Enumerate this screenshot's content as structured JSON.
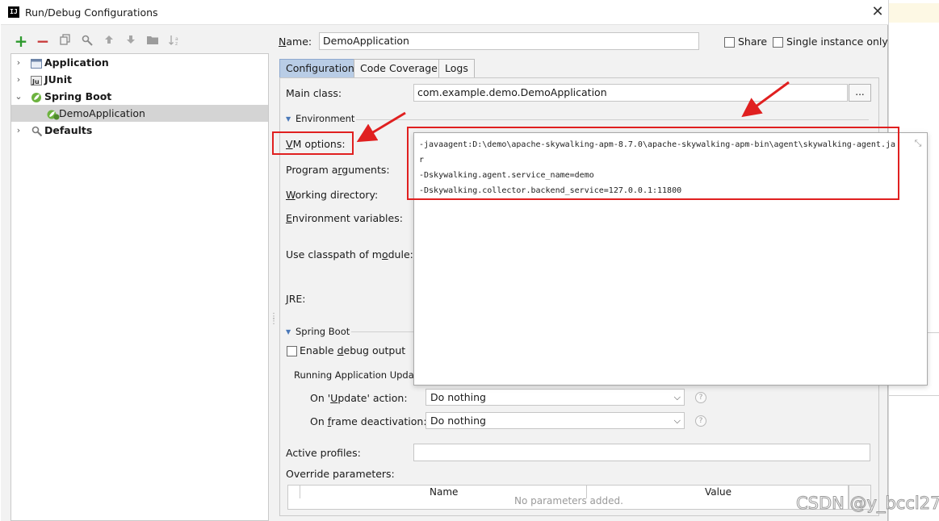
{
  "window": {
    "title": "Run/Debug Configurations",
    "app_icon": "IJ",
    "close_icon": "close-icon"
  },
  "toolbar": {
    "icons": [
      "add-icon",
      "remove-icon",
      "copy-icon",
      "edit-defaults-icon",
      "move-up-icon",
      "move-down-icon",
      "folder-icon",
      "sort-icon"
    ]
  },
  "tree": {
    "items": [
      {
        "label": "Application",
        "icon": "application-icon"
      },
      {
        "label": "JUnit",
        "icon": "junit-icon"
      },
      {
        "label": "Spring Boot",
        "icon": "spring-boot-icon"
      },
      {
        "label": "DemoApplication",
        "icon": "spring-app-icon"
      },
      {
        "label": "Defaults",
        "icon": "defaults-icon"
      }
    ]
  },
  "config": {
    "name_label": "Name:",
    "name_value": "DemoApplication",
    "share_label": "Share",
    "single_instance_label": "Single instance only",
    "tabs": [
      "Configuration",
      "Code Coverage",
      "Logs"
    ],
    "main_class_label": "Main class:",
    "main_class_value": "com.example.demo.DemoApplication",
    "browse_label": "...",
    "environment_section": "Environment",
    "vm_options_label": "VM options:",
    "program_arguments_label": "Program arguments:",
    "working_directory_label": "Working directory:",
    "environment_variables_label": "Environment variables:",
    "use_classpath_label": "Use classpath of module:",
    "jre_label": "JRE:",
    "spring_boot_section": "Spring Boot",
    "enable_debug_label": "Enable debug output",
    "running_updates_label": "Running Application Update",
    "on_update_label": "On 'Update' action:",
    "on_update_value": "Do nothing",
    "on_frame_label": "On frame deactivation:",
    "on_frame_value": "Do nothing",
    "active_profiles_label": "Active profiles:",
    "override_params_label": "Override parameters:",
    "table_headers": [
      "Name",
      "Value"
    ],
    "table_empty": "No parameters added."
  },
  "vm_popup": {
    "lines": [
      "-javaagent:D:\\demo\\apache-skywalking-apm-8.7.0\\apache-skywalking-apm-bin\\agent\\skywalking-agent.ja",
      "r",
      "-Dskywalking.agent.service_name=demo",
      "-Dskywalking.collector.backend_service=127.0.0.1:11800"
    ]
  },
  "watermark": "CSDN @y_bccl27",
  "annotation_color": "#e02020"
}
